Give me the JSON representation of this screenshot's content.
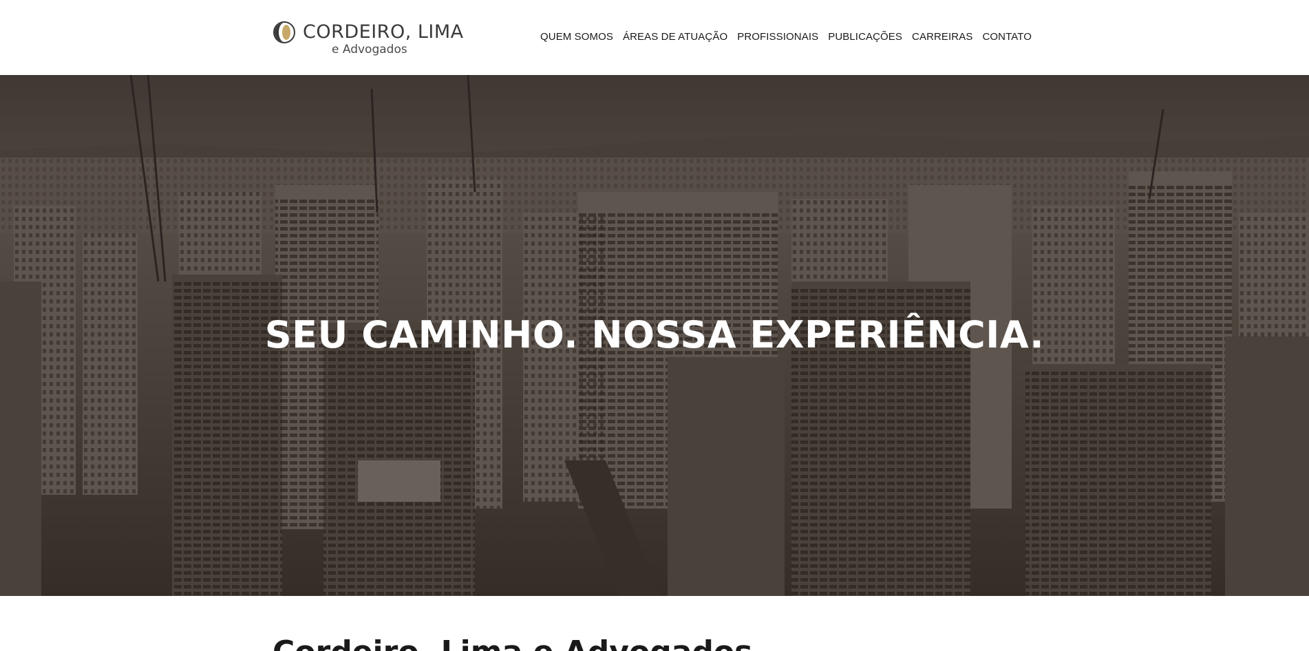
{
  "header": {
    "logo": {
      "name": "CORDEIRO, LIMA",
      "subtitle": "e Advogados"
    },
    "nav": [
      {
        "label": "QUEM SOMOS"
      },
      {
        "label": "ÁREAS DE ATUAÇÃO"
      },
      {
        "label": "PROFISSIONAIS"
      },
      {
        "label": "PUBLICAÇÕES"
      },
      {
        "label": "CARREIRAS"
      },
      {
        "label": "CONTATO"
      }
    ]
  },
  "hero": {
    "title": "SEU CAMINHO. NOSSA EXPERIÊNCIA.",
    "image": "aerial-city-skyline-photo"
  },
  "intro": {
    "heading": "Cordeiro, Lima e Advogados"
  },
  "colors": {
    "hero_tint": "#4a413b",
    "text_dark": "#1a1a1a",
    "logo_gold": "#c8a86a"
  }
}
